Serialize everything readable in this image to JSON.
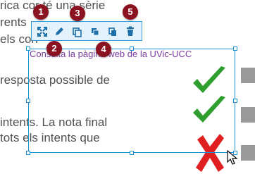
{
  "background_lines": {
    "line1": "rica cor té una sèrie",
    "line2": "rents",
    "line3": "els corr",
    "line4": "resposta possible de",
    "line5": "intents. La nota final",
    "line6": "tots els intents que"
  },
  "link_text": "Consulta la pàgina web de la UVic-UCC",
  "toolbar": {
    "buttons": [
      {
        "name": "fullscreen-icon"
      },
      {
        "name": "edit-pencil-icon"
      },
      {
        "name": "copy-icon"
      },
      {
        "name": "duplicate-icon"
      },
      {
        "name": "paste-icon"
      },
      {
        "name": "trash-icon"
      }
    ]
  },
  "badges": [
    "1",
    "2",
    "3",
    "4",
    "5"
  ],
  "colors": {
    "accent": "#1a90d6",
    "toolbar_bg": "#e4f3fb",
    "badge": "#8b1220",
    "link": "#7c3c9e",
    "check": "#2e9e2e",
    "cross": "#e02020"
  }
}
